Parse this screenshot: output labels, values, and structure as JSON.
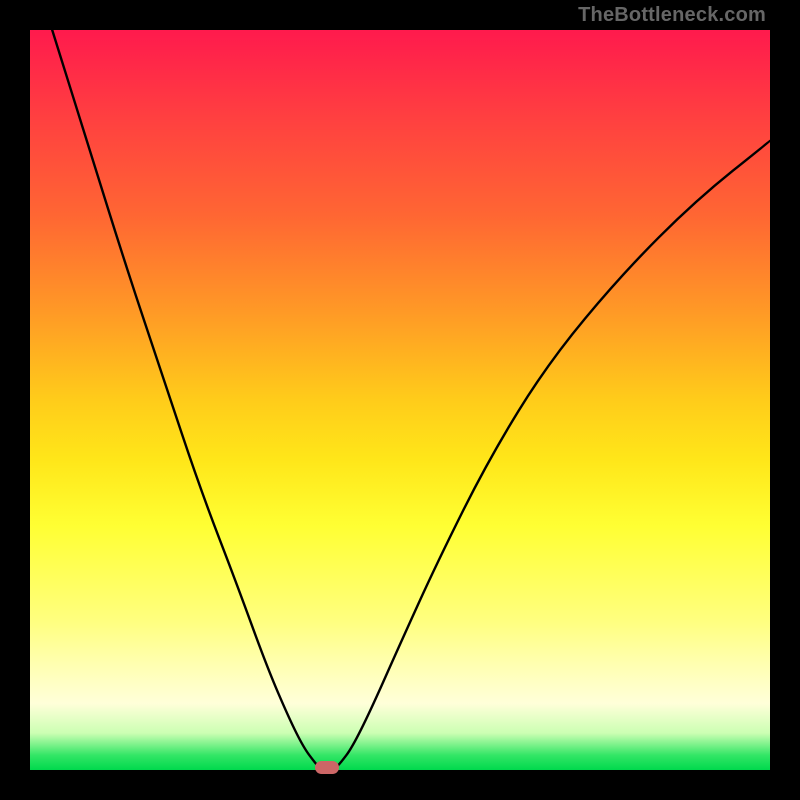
{
  "watermark": "TheBottleneck.com",
  "colors": {
    "background": "#000000",
    "gradient_top": "#ff1a4d",
    "gradient_bottom": "#00d94d",
    "curve": "#000000",
    "marker": "#cc6666",
    "watermark_text": "#666666"
  },
  "chart_data": {
    "type": "line",
    "title": "",
    "xlabel": "",
    "ylabel": "",
    "xlim": [
      0,
      100
    ],
    "ylim": [
      0,
      100
    ],
    "series": [
      {
        "name": "curve-left",
        "x": [
          3,
          8,
          13,
          18,
          23,
          28,
          32,
          35,
          37,
          38.5,
          39.2
        ],
        "y": [
          100,
          84,
          68,
          53,
          38,
          25,
          14,
          7,
          3,
          1,
          0.2
        ]
      },
      {
        "name": "curve-right",
        "x": [
          41.2,
          42,
          43.5,
          46,
          50,
          55,
          62,
          70,
          80,
          90,
          100
        ],
        "y": [
          0.2,
          1,
          3,
          8,
          17,
          28,
          42,
          55,
          67,
          77,
          85
        ]
      }
    ],
    "markers": [
      {
        "name": "primary-marker",
        "x": 40.2,
        "y": 0.3
      }
    ],
    "annotations": [
      {
        "text": "TheBottleneck.com",
        "position": "top-right"
      }
    ]
  }
}
